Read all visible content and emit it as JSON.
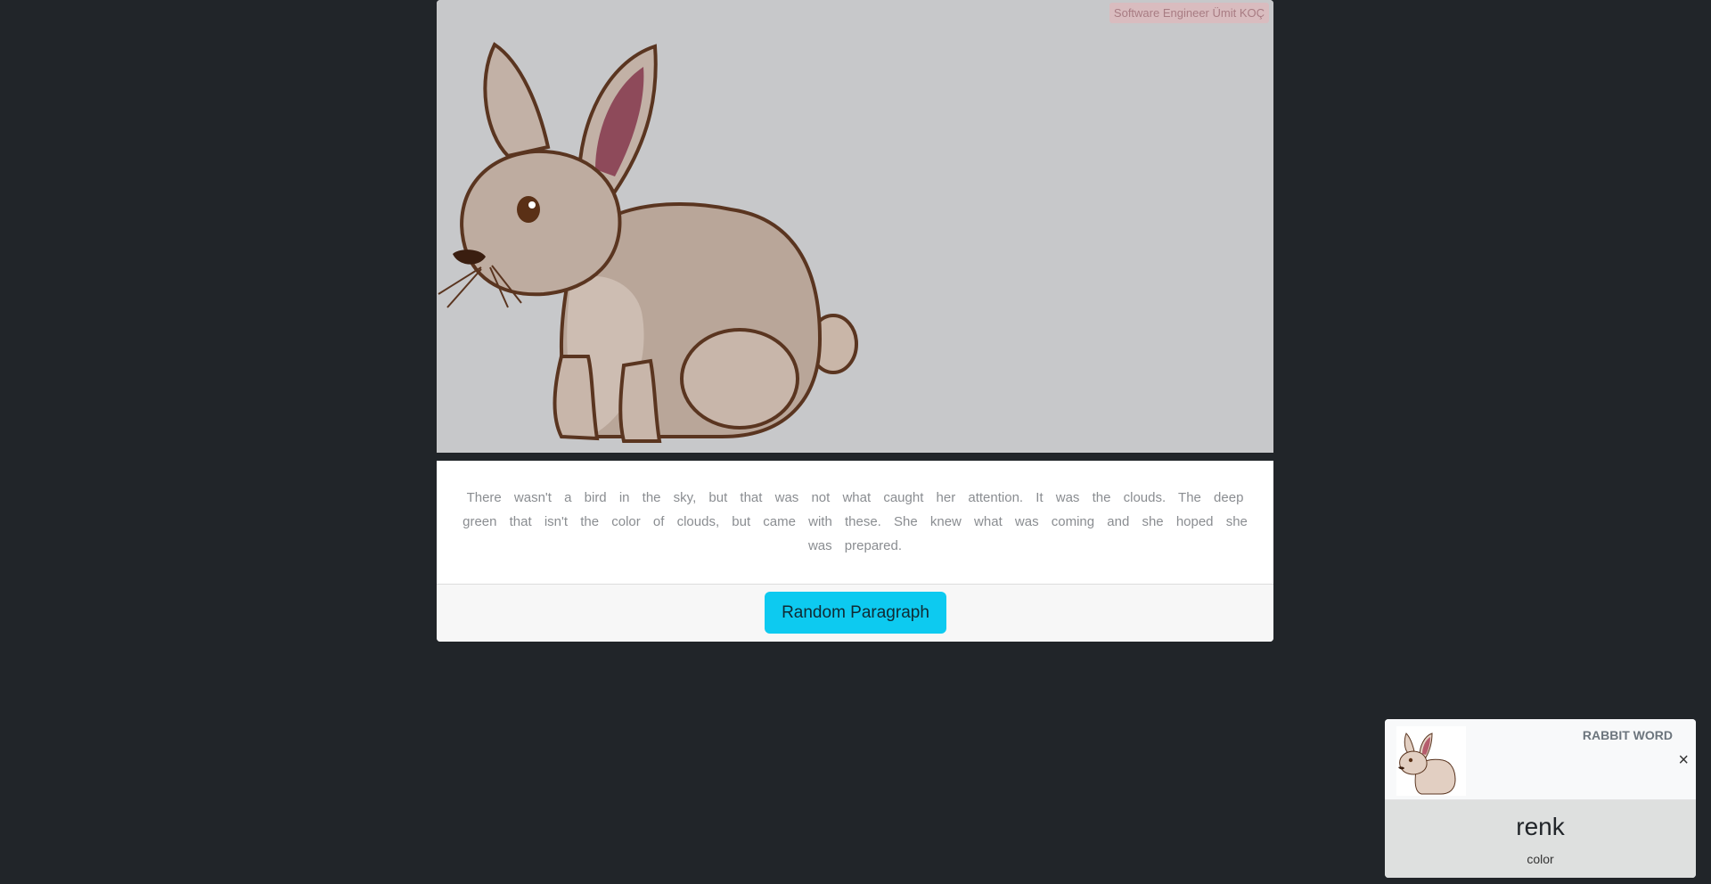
{
  "hero": {
    "credit": "Software Engineer Ümit KOÇ",
    "image": "rabbit-illustration"
  },
  "content": {
    "paragraph": "There wasn't a bird in the sky, but that was not what caught her attention. It was the clouds. The deep green that isn't the color of clouds, but came with these. She knew what was coming and she hoped she was prepared."
  },
  "footer": {
    "button_label": "Random Paragraph"
  },
  "toast": {
    "title": "RABBIT WORD",
    "close": "×",
    "word": "renk",
    "translation": "color",
    "thumbnail": "rabbit-icon"
  },
  "colors": {
    "background": "#212529",
    "button": "#0dcaf0",
    "image_bg": "#c7c8ca"
  }
}
